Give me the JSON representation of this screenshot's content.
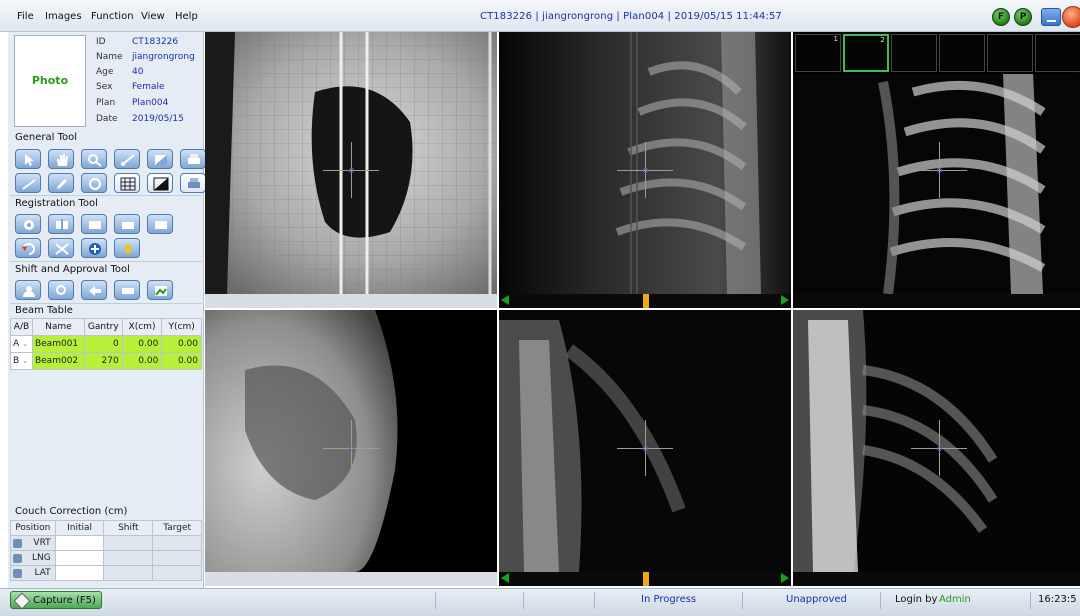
{
  "menu": [
    "File",
    "Images",
    "Function",
    "View",
    "Help"
  ],
  "title": "CT183226 | jiangrongrong | Plan004 | 2019/05/15 11:44:57",
  "title_buttons": {
    "f": "F",
    "p": "P"
  },
  "patient": {
    "photo_label": "Photo",
    "fields": [
      {
        "key": "ID",
        "value": "CT183226"
      },
      {
        "key": "Name",
        "value": "jiangrongrong"
      },
      {
        "key": "Age",
        "value": "40"
      },
      {
        "key": "Sex",
        "value": "Female"
      },
      {
        "key": "Plan",
        "value": "Plan004"
      },
      {
        "key": "Date",
        "value": "2019/05/15"
      }
    ]
  },
  "sections": {
    "general_tool": "General Tool",
    "registration_tool": "Registration Tool",
    "shift_approval_tool": "Shift and Approval Tool",
    "beam_table": "Beam Table",
    "couch_correction": "Couch Correction (cm)"
  },
  "beam_table": {
    "headers": [
      "A/B",
      "Name",
      "Gantry",
      "X(cm)",
      "Y(cm)"
    ],
    "rows": [
      {
        "ab": "A",
        "name": "Beam001",
        "gantry": "0",
        "x": "0.00",
        "y": "0.00"
      },
      {
        "ab": "B",
        "name": "Beam002",
        "gantry": "270",
        "x": "0.00",
        "y": "0.00"
      }
    ]
  },
  "couch_table": {
    "headers": [
      "Position",
      "Initial",
      "Shift",
      "Target"
    ],
    "rows": [
      "VRT",
      "LNG",
      "LAT"
    ]
  },
  "thumbnails": [
    "1",
    "2"
  ],
  "status": {
    "capture": "Capture (F5)",
    "progress": "In Progress",
    "approval": "Unapproved",
    "login_label": "Login by",
    "user": "Admin",
    "time": "16:23:5"
  },
  "colors": {
    "accent_blue": "#1a2fa8",
    "beam_green": "#b6f03a",
    "text_green": "#2a9a1a"
  }
}
